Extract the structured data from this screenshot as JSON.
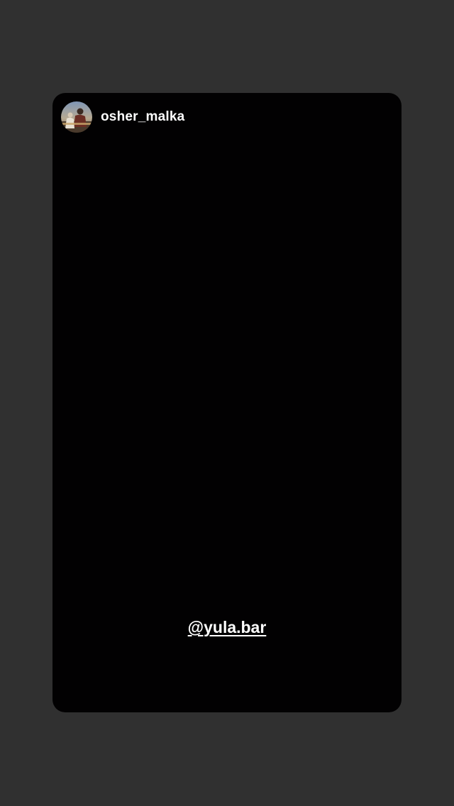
{
  "story": {
    "username": "osher_malka",
    "mention": "@yula.bar",
    "avatar_icon": "profile-photo-avatar"
  },
  "colors": {
    "page_background": "#303030",
    "story_background": "#020102",
    "text": "#ffffff"
  }
}
